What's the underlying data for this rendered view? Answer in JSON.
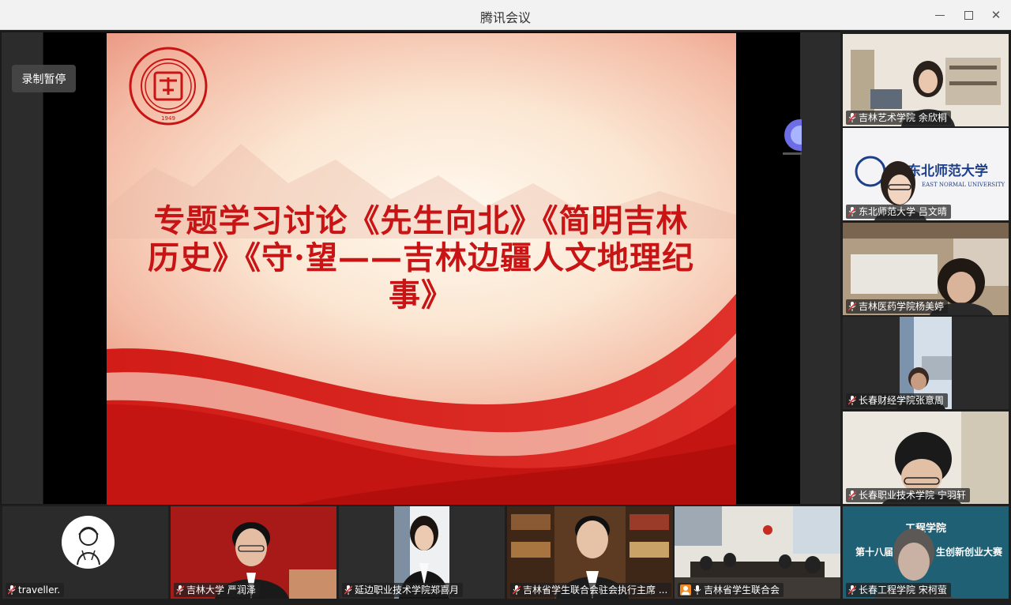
{
  "window": {
    "title": "腾讯会议"
  },
  "stage": {
    "record_pause_label": "录制暂停",
    "slide_title_line1": "专题学习讨论《先生向北》《简明吉林",
    "slide_title_line2": "历史》《守·望——吉林边疆人文地理纪",
    "slide_title_line3": "事》",
    "seal_year": "1949"
  },
  "right_participants": [
    {
      "label": "吉林艺术学院 余欣桐"
    },
    {
      "label": "东北师范大学 吕文晴"
    },
    {
      "label": "吉林医药学院杨美婷"
    },
    {
      "label": "长春财经学院张意周"
    },
    {
      "label": "长春职业技术学院 宁羽轩"
    }
  ],
  "right_tile2_sign": {
    "cn": "东北师范大学",
    "en": "EAST NORMAL UNIVERSITY"
  },
  "bottom_participants": [
    {
      "label": "traveller."
    },
    {
      "label": "吉林大学 严润泽"
    },
    {
      "label": "延边职业技术学院郑喜月"
    },
    {
      "label": "吉林省学生联合会驻会执行主席 ..."
    },
    {
      "label": "吉林省学生联合会"
    },
    {
      "label": "长春工程学院 宋柯萤"
    }
  ],
  "bottom_tile6_banner": {
    "line1": "工程学院",
    "line2": "第十八届",
    "line3": "生创新创业大赛"
  },
  "colors": {
    "accent_active": "#1fb85a",
    "slide_title": "#c81414",
    "mic_red": "#e23b3b"
  }
}
